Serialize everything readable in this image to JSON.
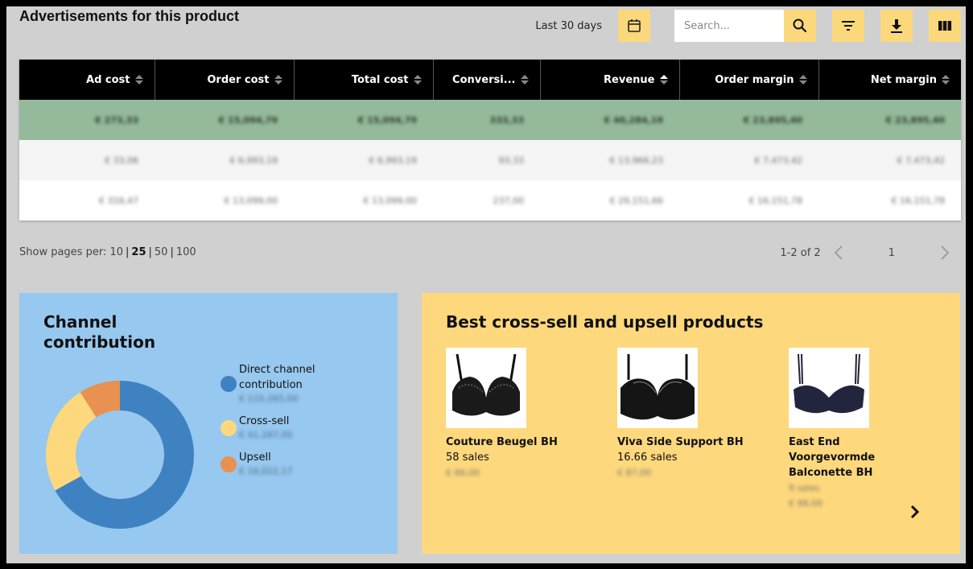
{
  "page": {
    "title": "Advertisements for this product"
  },
  "toolbar": {
    "date_range_label": "Last 30 days",
    "search_placeholder": "Search...",
    "search_value": "",
    "icons": [
      "calendar-icon",
      "search-icon",
      "filter-icon",
      "download-icon",
      "columns-icon"
    ]
  },
  "table": {
    "columns": [
      {
        "label": "Ad cost",
        "sort": "none"
      },
      {
        "label": "Order cost",
        "sort": "none"
      },
      {
        "label": "Total cost",
        "sort": "none"
      },
      {
        "label": "Conversi...",
        "sort": "none"
      },
      {
        "label": "Revenue",
        "sort": "asc"
      },
      {
        "label": "Order margin",
        "sort": "none"
      },
      {
        "label": "Net margin",
        "sort": "none"
      }
    ],
    "rows": [
      {
        "style": "highlight",
        "cells": [
          "€ 273,33",
          "€ 15,094,79",
          "€ 15,094,79",
          "333,33",
          "€ 40,284,19",
          "€ 23,895,40",
          "€ 23,895,40"
        ]
      },
      {
        "style": "alt",
        "cells": [
          "€ 33,06",
          "€ 6,993,19",
          "€ 6,993,19",
          "93,33",
          "€ 13,966,23",
          "€ 7,473,42",
          "€ 7,473,42"
        ]
      },
      {
        "style": "plain",
        "cells": [
          "€ 316,47",
          "€ 13,099,00",
          "€ 13,099,00",
          "237,00",
          "€ 29,151,66",
          "€ 16,151,78",
          "€ 16,151,78"
        ]
      }
    ],
    "note": "cell values are blurred in the screenshot; approximations"
  },
  "pagination": {
    "label": "Show pages per:",
    "options": [
      "10",
      "25",
      "50",
      "100"
    ],
    "active": "25",
    "range_text": "1-2 of 2",
    "current_page": "1"
  },
  "channel": {
    "title": "Channel contribution",
    "legend": [
      {
        "label": "Direct channel contribution",
        "value": "€ 115,265,00",
        "color": "#3f82c2"
      },
      {
        "label": "Cross-sell",
        "value": "€ 41,287,00",
        "color": "#fdd87c"
      },
      {
        "label": "Upsell",
        "value": "€ 16,022,17",
        "color": "#e89150"
      }
    ]
  },
  "chart_data": {
    "type": "pie",
    "title": "Channel contribution",
    "donut": true,
    "categories": [
      "Direct channel contribution",
      "Cross-sell",
      "Upsell"
    ],
    "values": [
      67,
      24,
      9
    ],
    "unit": "percent (estimated from slice angles)",
    "colors": [
      "#3f82c2",
      "#fdd87c",
      "#e89150"
    ],
    "legend_position": "right"
  },
  "products_card": {
    "title": "Best cross-sell and upsell products",
    "items": [
      {
        "name": "Couture Beugel BH",
        "sales": "58 sales",
        "price": "€ 86,00",
        "image": "black-lace-bra"
      },
      {
        "name": "Viva Side Support BH",
        "sales": "16.66 sales",
        "price": "€ 87,00",
        "image": "black-side-support-bra"
      },
      {
        "name": "East End Voorgevormde Balconette BH",
        "sales": "9 sales",
        "price": "€ 98,00",
        "image": "navy-balconette-bra"
      }
    ]
  }
}
